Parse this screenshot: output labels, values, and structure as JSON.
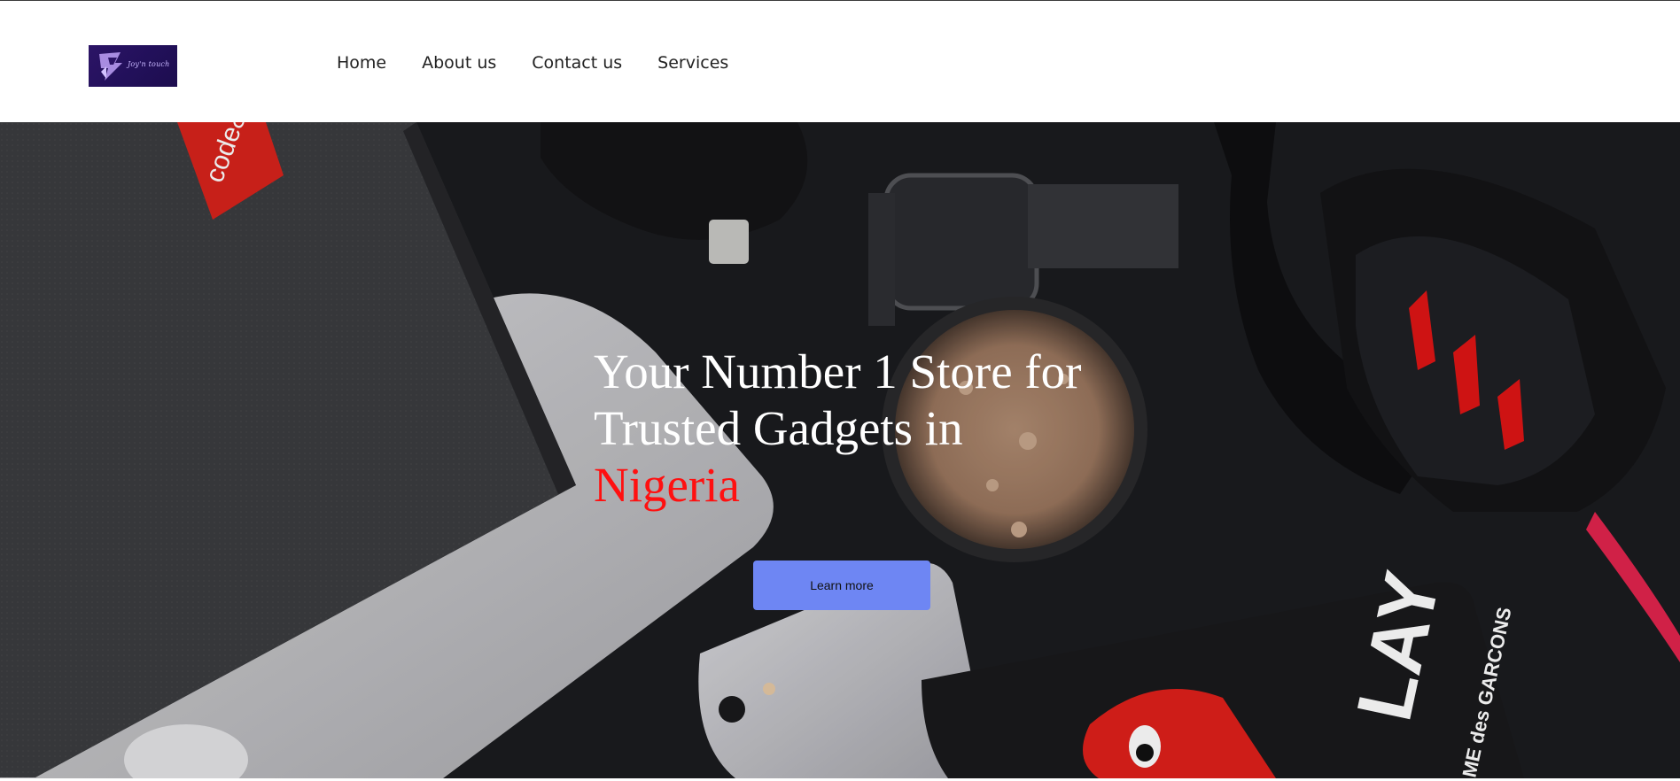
{
  "brand": {
    "logo_text": "Joy'n touch",
    "logo_bg": "#24115e"
  },
  "nav": {
    "items": [
      {
        "label": "Home"
      },
      {
        "label": "About us"
      },
      {
        "label": "Contact us"
      },
      {
        "label": "Services"
      }
    ]
  },
  "hero": {
    "title_line": "Your Number 1 Store for Trusted Gadgets in",
    "title_accent": "Nigeria",
    "accent_color": "#ff1010",
    "cta_label": "Learn more",
    "cta_color": "#6e86f3",
    "phone_case_text": "LAY",
    "phone_case_subtext": "ME des GARCONS",
    "notebook_tag": "code&"
  }
}
